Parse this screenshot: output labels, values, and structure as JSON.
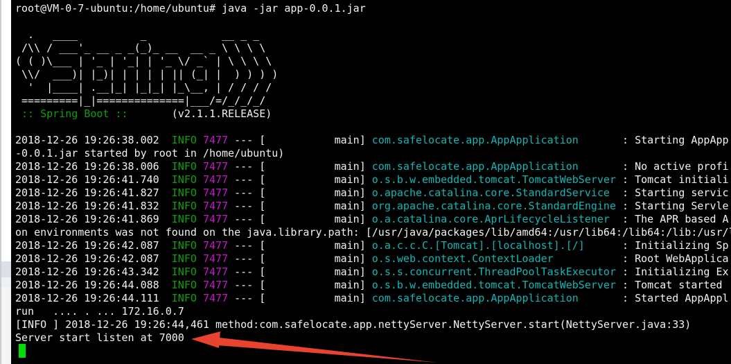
{
  "colors": {
    "background": "#000000",
    "foreground": "#f2f2f2",
    "log_green": "#0ca00c",
    "log_magenta": "#c616c6",
    "log_cyan": "#13b5b5",
    "cursor_green": "#00dd00",
    "arrow_red": "#e8432e",
    "strip_white": "#ffffff",
    "strip_gray": "#dce0e4",
    "strip_light": "#f5f5f5"
  },
  "terminal": {
    "lines": [
      {
        "kind": "text",
        "text": "root@VM-0-7-ubuntu:/home/ubuntu# java -jar app-0.0.1.jar"
      },
      {
        "kind": "blank"
      },
      {
        "kind": "text",
        "text": "  .   ____          _            __ _ _"
      },
      {
        "kind": "text",
        "text": " /\\\\ / ___'_ __ _ _(_)_ __  __ _ \\ \\ \\ \\"
      },
      {
        "kind": "text",
        "text": "( ( )\\___ | '_ | '_| | '_ \\/ _` | \\ \\ \\ \\"
      },
      {
        "kind": "text",
        "text": " \\\\/  ___)| |_)| | | | | || (_| |  ) ) ) )"
      },
      {
        "kind": "text",
        "text": "  '  |____| .__|_| |_|_| |_\\__, | / / / /"
      },
      {
        "kind": "text",
        "text": " =========|_|==============|___/=/_/_/_/"
      },
      {
        "kind": "banner_footer",
        "label": " :: Spring Boot ::",
        "gap": "       ",
        "version": "(v2.1.1.RELEASE)"
      },
      {
        "kind": "blank"
      },
      {
        "kind": "log",
        "timestamp": "2018-12-26 19:26:38.002",
        "level": "INFO",
        "pid": "7477",
        "thread": "main",
        "logger": "com.safelocate.app.AppApplication",
        "message": "Starting AppApp"
      },
      {
        "kind": "text",
        "text": "-0.0.1.jar started by root in /home/ubuntu)"
      },
      {
        "kind": "log",
        "timestamp": "2018-12-26 19:26:38.006",
        "level": "INFO",
        "pid": "7477",
        "thread": "main",
        "logger": "com.safelocate.app.AppApplication",
        "message": "No active profi"
      },
      {
        "kind": "log",
        "timestamp": "2018-12-26 19:26:41.740",
        "level": "INFO",
        "pid": "7477",
        "thread": "main",
        "logger": "o.s.b.w.embedded.tomcat.TomcatWebServer",
        "message": "Tomcat initiali"
      },
      {
        "kind": "log",
        "timestamp": "2018-12-26 19:26:41.827",
        "level": "INFO",
        "pid": "7477",
        "thread": "main",
        "logger": "o.apache.catalina.core.StandardService",
        "message": "Starting servic"
      },
      {
        "kind": "log",
        "timestamp": "2018-12-26 19:26:41.832",
        "level": "INFO",
        "pid": "7477",
        "thread": "main",
        "logger": "org.apache.catalina.core.StandardEngine",
        "message": "Starting Servle"
      },
      {
        "kind": "log",
        "timestamp": "2018-12-26 19:26:41.869",
        "level": "INFO",
        "pid": "7477",
        "thread": "main",
        "logger": "o.a.catalina.core.AprLifecycleListener",
        "message": "The APR based A"
      },
      {
        "kind": "text",
        "text": "on environments was not found on the java.library.path: [/usr/java/packages/lib/amd64:/usr/lib64:/lib64:/lib:/usr/l"
      },
      {
        "kind": "log",
        "timestamp": "2018-12-26 19:26:42.087",
        "level": "INFO",
        "pid": "7477",
        "thread": "main",
        "logger": "o.a.c.c.C.[Tomcat].[localhost].[/]",
        "message": "Initializing Sp"
      },
      {
        "kind": "log",
        "timestamp": "2018-12-26 19:26:42.087",
        "level": "INFO",
        "pid": "7477",
        "thread": "main",
        "logger": "o.s.web.context.ContextLoader",
        "message": "Root WebApplica"
      },
      {
        "kind": "log",
        "timestamp": "2018-12-26 19:26:43.342",
        "level": "INFO",
        "pid": "7477",
        "thread": "main",
        "logger": "o.s.s.concurrent.ThreadPoolTaskExecutor",
        "message": "Initializing Ex"
      },
      {
        "kind": "log",
        "timestamp": "2018-12-26 19:26:44.088",
        "level": "INFO",
        "pid": "7477",
        "thread": "main",
        "logger": "o.s.b.w.embedded.tomcat.TomcatWebServer",
        "message": "Tomcat started "
      },
      {
        "kind": "log",
        "timestamp": "2018-12-26 19:26:44.111",
        "level": "INFO",
        "pid": "7477",
        "thread": "main",
        "logger": "com.safelocate.app.AppApplication",
        "message": "Started AppAppl"
      },
      {
        "kind": "text",
        "text": "run   .... . ... 172.16.0.7"
      },
      {
        "kind": "text",
        "text": "[INFO ] 2018-12-26 19:26:44,461 method:com.safelocate.app.nettyServer.NettyServer.start(NettyServer.java:33)"
      },
      {
        "kind": "text",
        "text": "Server start listen at 7000"
      }
    ]
  },
  "annotation": {
    "shape": "arrow",
    "points_at_text": "Server start listen at 7000"
  }
}
